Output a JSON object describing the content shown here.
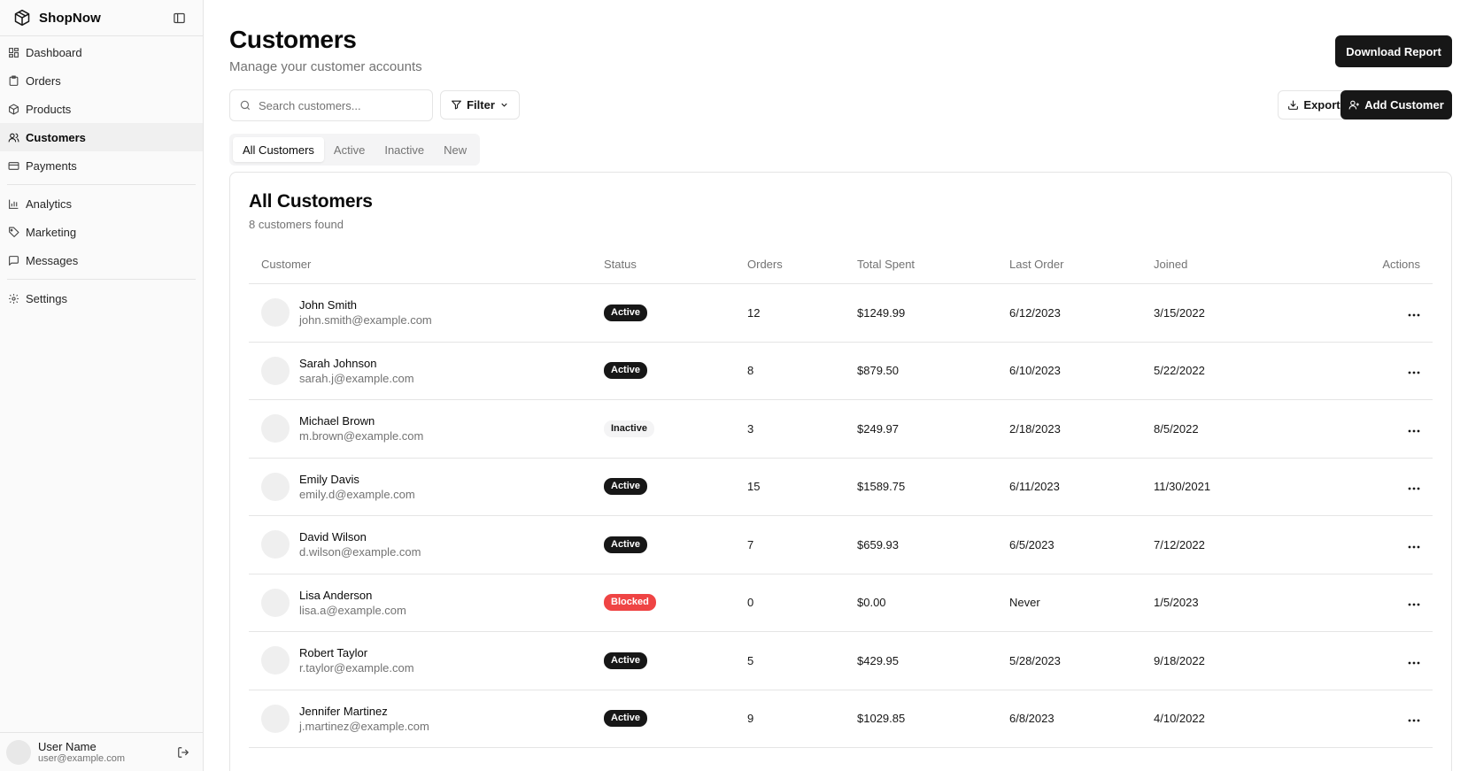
{
  "app": {
    "name": "ShopNow"
  },
  "sidebar": {
    "items": [
      {
        "label": "Dashboard",
        "icon": "dashboard-icon"
      },
      {
        "label": "Orders",
        "icon": "clipboard-icon"
      },
      {
        "label": "Products",
        "icon": "package-icon"
      },
      {
        "label": "Customers",
        "icon": "users-icon"
      },
      {
        "label": "Payments",
        "icon": "credit-card-icon"
      },
      {
        "label": "Analytics",
        "icon": "bar-chart-icon"
      },
      {
        "label": "Marketing",
        "icon": "tag-icon"
      },
      {
        "label": "Messages",
        "icon": "message-icon"
      },
      {
        "label": "Settings",
        "icon": "gear-icon"
      }
    ],
    "active": "Customers",
    "user": {
      "name": "User Name",
      "email": "user@example.com"
    }
  },
  "header": {
    "title": "Customers",
    "subtitle": "Manage your customer accounts",
    "download_label": "Download Report"
  },
  "toolbar": {
    "search_placeholder": "Search customers...",
    "filter_label": "Filter",
    "export_label": "Export",
    "add_label": "Add Customer"
  },
  "tabs": [
    {
      "label": "All Customers",
      "active": true
    },
    {
      "label": "Active",
      "active": false
    },
    {
      "label": "Inactive",
      "active": false
    },
    {
      "label": "New",
      "active": false
    }
  ],
  "card": {
    "title": "All Customers",
    "subtitle": "8 customers found"
  },
  "table": {
    "columns": [
      "Customer",
      "Status",
      "Orders",
      "Total Spent",
      "Last Order",
      "Joined",
      "Actions"
    ],
    "rows": [
      {
        "name": "John Smith",
        "email": "john.smith@example.com",
        "status": "Active",
        "orders": "12",
        "spent": "$1249.99",
        "last_order": "6/12/2023",
        "joined": "3/15/2022"
      },
      {
        "name": "Sarah Johnson",
        "email": "sarah.j@example.com",
        "status": "Active",
        "orders": "8",
        "spent": "$879.50",
        "last_order": "6/10/2023",
        "joined": "5/22/2022"
      },
      {
        "name": "Michael Brown",
        "email": "m.brown@example.com",
        "status": "Inactive",
        "orders": "3",
        "spent": "$249.97",
        "last_order": "2/18/2023",
        "joined": "8/5/2022"
      },
      {
        "name": "Emily Davis",
        "email": "emily.d@example.com",
        "status": "Active",
        "orders": "15",
        "spent": "$1589.75",
        "last_order": "6/11/2023",
        "joined": "11/30/2021"
      },
      {
        "name": "David Wilson",
        "email": "d.wilson@example.com",
        "status": "Active",
        "orders": "7",
        "spent": "$659.93",
        "last_order": "6/5/2023",
        "joined": "7/12/2022"
      },
      {
        "name": "Lisa Anderson",
        "email": "lisa.a@example.com",
        "status": "Blocked",
        "orders": "0",
        "spent": "$0.00",
        "last_order": "Never",
        "joined": "1/5/2023"
      },
      {
        "name": "Robert Taylor",
        "email": "r.taylor@example.com",
        "status": "Active",
        "orders": "5",
        "spent": "$429.95",
        "last_order": "5/28/2023",
        "joined": "9/18/2022"
      },
      {
        "name": "Jennifer Martinez",
        "email": "j.martinez@example.com",
        "status": "Active",
        "orders": "9",
        "spent": "$1029.85",
        "last_order": "6/8/2023",
        "joined": "4/10/2022"
      }
    ]
  },
  "colors": {
    "primary": "#171717",
    "muted": "#737373",
    "border": "#e5e5e5",
    "danger": "#ef4444"
  }
}
